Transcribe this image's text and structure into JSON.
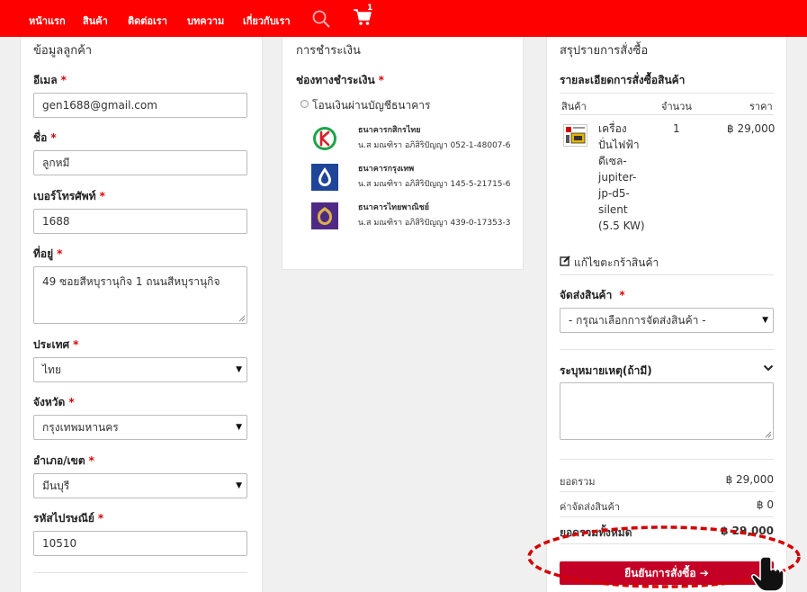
{
  "nav": {
    "items": [
      "หน้าแรก",
      "สินค้า",
      "ติดต่อเรา",
      "บทความ",
      "เกี่ยวกับเรา"
    ],
    "cart_count": "1"
  },
  "customer": {
    "title": "ข้อมูลลูกค้า",
    "email_label": "อีเมล",
    "email_value": "gen1688@gmail.com",
    "name_label": "ชื่อ",
    "name_value": "ลูกหมี",
    "phone_label": "เบอร์โทรศัพท์",
    "phone_value": "1688",
    "address_label": "ที่อยู่",
    "address_value": "49 ซอยสีหบุรานุกิจ 1 ถนนสีหบุรานุกิจ",
    "country_label": "ประเทศ",
    "country_value": "ไทย",
    "province_label": "จังหวัด",
    "province_value": "กรุงเทพมหานคร",
    "district_label": "อำเภอ/เขต",
    "district_value": "มีนบุรี",
    "zip_label": "รหัสไปรษณีย์",
    "zip_value": "10510",
    "required_mark": "*"
  },
  "payment": {
    "title": "การชำระเงิน",
    "channel_label": "ช่องทางชำระเงิน",
    "option_label": "โอนเงินผ่านบัญชีธนาคาร",
    "banks": [
      {
        "name": "ธนาคารกสิกรไทย",
        "account": "น.ส มณฑิรา อภิสิริปัญญา 052-1-48007-6",
        "color": "#1ba548",
        "icon": "kasikorn-logo"
      },
      {
        "name": "ธนาคารกรุงเทพ",
        "account": "น.ส มณฑิรา อภิสิริปัญญา 145-5-21715-6",
        "color": "#1e4598",
        "icon": "bangkok-bank-logo"
      },
      {
        "name": "ธนาคารไทยพาณิชย์",
        "account": "น.ส มณฑิรา อภิสิริปัญญา 439-0-17353-3",
        "color": "#4e2a84",
        "icon": "scb-logo"
      }
    ]
  },
  "summary": {
    "title": "สรุปรายการสั่งซื้อ",
    "details_label": "รายละเอียดการสั่งซื้อสินค้า",
    "col_product": "สินค้า",
    "col_qty": "จำนวน",
    "col_price": "ราคา",
    "product_name": "เครื่องปั่นไฟฟ้าดีเซล-jupiter-jp-d5-silent (5.5 KW)",
    "product_qty": "1",
    "product_price": "฿ 29,000",
    "edit_cart": "แก้ไขตะกร้าสินค้า",
    "shipping_label": "จัดส่งสินค้า",
    "shipping_placeholder": "- กรุณาเลือกการจัดส่งสินค้า -",
    "note_label": "ระบุหมายเหตุ(ถ้ามี)",
    "subtotal_label": "ยอดรวม",
    "subtotal_value": "฿ 29,000",
    "shipping_cost_label": "ค่าจัดส่งสินค้า",
    "shipping_cost_value": "฿ 0",
    "grand_total_label": "ยอดรวมทั้งหมด",
    "grand_total_value": "฿ 29,000",
    "confirm_label": "ยืนยันการสั่งซื้อ ➔"
  },
  "colors": {
    "nav": "#ff0000",
    "confirm": "#c40026",
    "highlight": "#d40000"
  }
}
